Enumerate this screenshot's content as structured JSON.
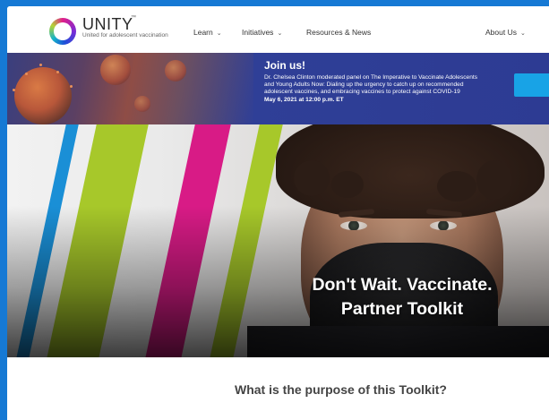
{
  "brand": {
    "name": "UNITY",
    "trademark": "™",
    "tagline": "United for adolescent vaccination"
  },
  "nav": {
    "items": [
      {
        "label": "Learn",
        "has_dropdown": true
      },
      {
        "label": "Initiatives",
        "has_dropdown": true
      },
      {
        "label": "Resources & News",
        "has_dropdown": false
      },
      {
        "label": "About Us",
        "has_dropdown": true
      }
    ],
    "chevron": "⌄"
  },
  "banner": {
    "title": "Join us!",
    "text": "Dr. Chelsea Clinton moderated panel on The Imperative to Vaccinate Adolescents and Young Adults Now: Dialing up the urgency to catch up on recommended adolescent vaccines, and embracing vaccines to protect against COVID-19",
    "date": "May 6, 2021 at 12:00 p.m. ET"
  },
  "hero": {
    "title_line1": "Don't Wait. Vaccinate.",
    "title_line2": "Partner Toolkit"
  },
  "section": {
    "title": "What is the purpose of this Toolkit?"
  },
  "colors": {
    "page_border": "#1679d4",
    "banner_bg": "#2f3f97",
    "banner_button": "#18a3e6",
    "stripe_blue": "#1a8fd6",
    "stripe_green": "#a7c82a",
    "stripe_magenta": "#d81b86"
  }
}
